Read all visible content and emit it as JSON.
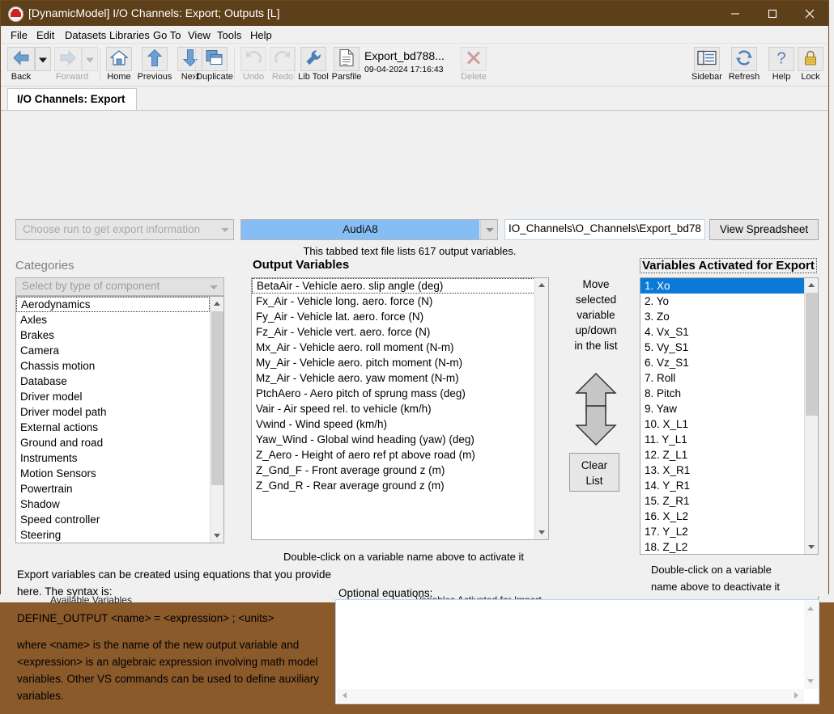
{
  "window": {
    "title": "[DynamicModel] I/O Channels: Export; Outputs [L]",
    "app_icon": "carsim-car-icon",
    "minimize": "–",
    "maximize": "□",
    "close": "✕",
    "titlebar_color": "#5d3f1a"
  },
  "menu": [
    {
      "label": "File"
    },
    {
      "label": "Edit"
    },
    {
      "label": "Datasets"
    },
    {
      "label": "Libraries"
    },
    {
      "label": "Go To"
    },
    {
      "label": "View"
    },
    {
      "label": "Tools"
    },
    {
      "label": "Help"
    }
  ],
  "toolbar": {
    "buttons": [
      {
        "label": "Back",
        "icon": "arrow-left-icon",
        "enabled": true,
        "has_dropdown": true
      },
      {
        "label": "Forward",
        "icon": "arrow-right-icon",
        "enabled": false,
        "has_dropdown": true
      },
      {
        "label": "Home",
        "icon": "home-icon",
        "enabled": true
      },
      {
        "label": "Previous",
        "icon": "arrow-up-icon",
        "enabled": true
      },
      {
        "label": "Next",
        "icon": "arrow-down-icon",
        "enabled": true
      },
      {
        "label": "Duplicate",
        "icon": "duplicate-icon",
        "enabled": true
      },
      {
        "label": "Undo",
        "icon": "undo-icon",
        "enabled": false
      },
      {
        "label": "Redo",
        "icon": "redo-icon",
        "enabled": false
      },
      {
        "label": "Lib Tool",
        "icon": "wrench-icon",
        "enabled": true
      },
      {
        "label": "Parsfile",
        "icon": "document-icon",
        "enabled": true
      }
    ],
    "file_name": "Export_bd788...",
    "file_date": "09-04-2024 17:16:43",
    "delete_label": "Delete",
    "right_buttons": [
      {
        "label": "Sidebar",
        "icon": "sidebar-icon"
      },
      {
        "label": "Refresh",
        "icon": "refresh-icon"
      },
      {
        "label": "Help",
        "icon": "question-mark-icon"
      },
      {
        "label": "Lock",
        "icon": "padlock-icon"
      }
    ]
  },
  "tab": {
    "label": "I/O Channels: Export"
  },
  "top_row": {
    "run_combo_placeholder": "Choose run to get export information",
    "dataset_combo_value": "AudiA8",
    "dataset_combo_color": "#87bdf5",
    "path_value": "IO_Channels\\O_Channels\\Export_bd78",
    "view_spreadsheet_label": "View Spreadsheet",
    "file_note": "This tabbed text file lists 617 output variables."
  },
  "categories": {
    "title": "Categories",
    "selector_placeholder": "Select by type of component",
    "items": [
      "Aerodynamics",
      "Axles",
      "Brakes",
      "Camera",
      "Chassis motion",
      "Database",
      "Driver model",
      "Driver model path",
      "External actions",
      "Ground and road",
      "Instruments",
      "Motion Sensors",
      "Powertrain",
      "Shadow",
      "Speed controller",
      "Steering"
    ],
    "selected_index": 0
  },
  "output_variables": {
    "title": "Output Variables",
    "items": [
      "BetaAir - Vehicle aero. slip angle (deg)",
      "Fx_Air - Vehicle long. aero. force (N)",
      "Fy_Air - Vehicle lat. aero. force (N)",
      "Fz_Air - Vehicle vert. aero. force (N)",
      "Mx_Air - Vehicle aero. roll moment (N-m)",
      "My_Air - Vehicle aero. pitch moment (N-m)",
      "Mz_Air - Vehicle aero. yaw moment (N-m)",
      "PtchAero - Aero pitch of sprung mass (deg)",
      "Vair - Air speed rel. to vehicle (km/h)",
      "Vwind - Wind speed (km/h)",
      "Yaw_Wind - Global wind heading (yaw) (deg)",
      "Z_Aero - Height of aero ref pt above road (m)",
      "Z_Gnd_F - Front average ground z (m)",
      "Z_Gnd_R - Rear average ground z (m)"
    ],
    "selected_index": 0,
    "hint": "Double-click on a variable name above to activate it"
  },
  "move_column": {
    "caption_lines": [
      "Move",
      "selected",
      "variable",
      "up/down",
      "in the list"
    ],
    "up_icon": "move-up-arrow-icon",
    "down_icon": "move-down-arrow-icon",
    "clear_label_lines": [
      "Clear",
      "List"
    ]
  },
  "activated": {
    "title": "Variables Activated for Export",
    "items": [
      "1. Xo",
      "2. Yo",
      "3. Zo",
      "4. Vx_S1",
      "5. Vy_S1",
      "6. Vz_S1",
      "7. Roll",
      "8. Pitch",
      "9. Yaw",
      "10. X_L1",
      "11. Y_L1",
      "12. Z_L1",
      "13. X_R1",
      "14. Y_R1",
      "15. Z_R1",
      "16. X_L2",
      "17. Y_L2",
      "18. Z_L2"
    ],
    "selected_index": 0,
    "selection_color": "#0b7ad6",
    "hint_lines": [
      "Double-click on a variable",
      "name above to deactivate it"
    ]
  },
  "help_text": {
    "paragraphs": [
      "Export variables can be created using equations that you provide here. The syntax is:",
      "DEFINE_OUTPUT <name> = <expression> ; <units>",
      "where <name> is the name of the new output variable and <expression> is an algebraic expression involving math model variables. Other VS commands can be used to define auxiliary variables."
    ]
  },
  "equations": {
    "label": "Optional equations:",
    "value": ""
  },
  "background_window": {
    "left_label": "Available Variables",
    "right_label": "Variables Activated for Import"
  }
}
